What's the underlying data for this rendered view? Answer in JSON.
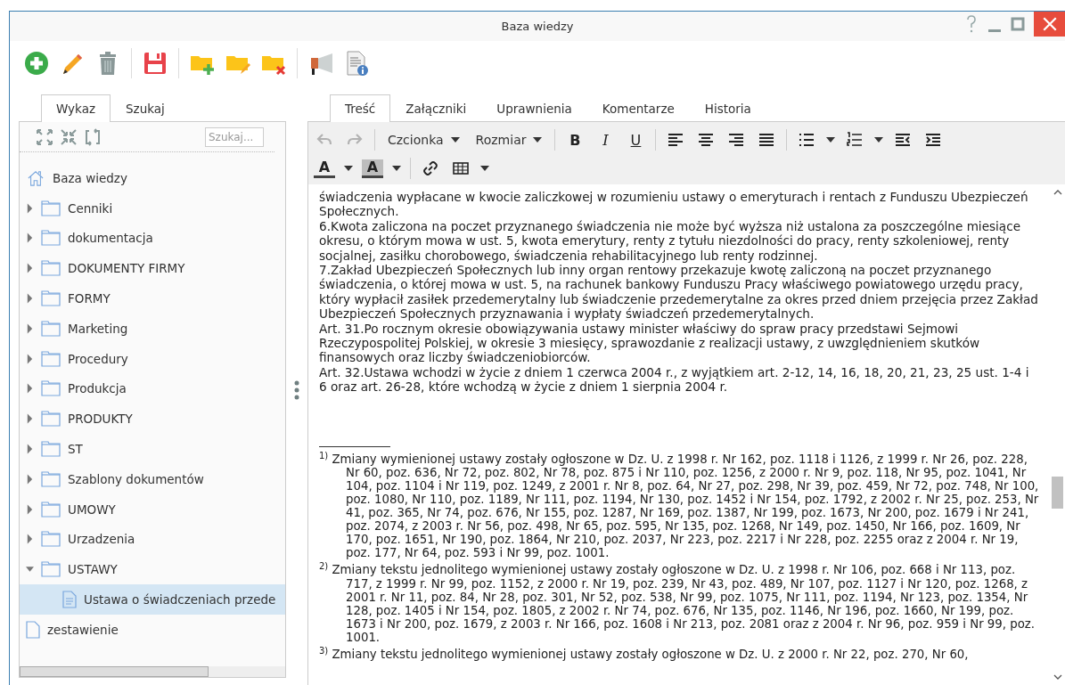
{
  "window": {
    "title": "Baza wiedzy"
  },
  "left_tabs": [
    {
      "label": "Wykaz",
      "selected": true
    },
    {
      "label": "Szukaj",
      "selected": false
    }
  ],
  "tree_search": {
    "placeholder": "Szukaj..."
  },
  "tree": [
    {
      "kind": "root",
      "label": "Baza wiedzy",
      "selected": false
    },
    {
      "kind": "folder",
      "label": "Cenniki",
      "expanded": false,
      "selected": false
    },
    {
      "kind": "folder",
      "label": "dokumentacja",
      "expanded": false,
      "selected": false
    },
    {
      "kind": "folder",
      "label": "DOKUMENTY FIRMY",
      "expanded": false,
      "selected": false
    },
    {
      "kind": "folder",
      "label": "FORMY",
      "expanded": false,
      "selected": false
    },
    {
      "kind": "folder",
      "label": "Marketing",
      "expanded": false,
      "selected": false
    },
    {
      "kind": "folder",
      "label": "Procedury",
      "expanded": false,
      "selected": false
    },
    {
      "kind": "folder",
      "label": "Produkcja",
      "expanded": false,
      "selected": false
    },
    {
      "kind": "folder",
      "label": "PRODUKTY",
      "expanded": false,
      "selected": false
    },
    {
      "kind": "folder",
      "label": "ST",
      "expanded": false,
      "selected": false
    },
    {
      "kind": "folder",
      "label": "Szablony dokumentów",
      "expanded": false,
      "selected": false
    },
    {
      "kind": "folder",
      "label": "UMOWY",
      "expanded": false,
      "selected": false
    },
    {
      "kind": "folder",
      "label": "Urzadzenia",
      "expanded": false,
      "selected": false
    },
    {
      "kind": "folder",
      "label": "USTAWY",
      "expanded": true,
      "selected": false,
      "children": [
        {
          "kind": "document",
          "label": "Ustawa o świadczeniach przede",
          "selected": true
        }
      ]
    },
    {
      "kind": "file",
      "label": "zestawienie",
      "selected": false
    }
  ],
  "right_tabs": [
    {
      "label": "Treść",
      "selected": true
    },
    {
      "label": "Załączniki",
      "selected": false
    },
    {
      "label": "Uprawnienia",
      "selected": false
    },
    {
      "label": "Komentarze",
      "selected": false
    },
    {
      "label": "Historia",
      "selected": false
    }
  ],
  "editor_toolbar": {
    "font": "Czcionka",
    "size": "Rozmiar",
    "bold": "B",
    "italic": "I",
    "underline": "U",
    "text_color": "A",
    "highlight": "A"
  },
  "content": [
    "świadczenia wypłacane w kwocie zaliczkowej w rozumieniu ustawy o emeryturach i rentach z Funduszu Ubezpieczeń Społecznych.",
    "6.Kwota zaliczona na poczet przyznanego świadczenia nie może być wyższa niż ustalona za poszczególne miesiące okresu, o którym mowa w ust. 5, kwota emerytury, renty z tytułu niezdolności do pracy, renty szkoleniowej, renty socjalnej, zasiłku chorobowego, świadczenia rehabilitacyjnego lub renty rodzinnej.",
    "7.Zakład Ubezpieczeń Społecznych lub inny organ rentowy przekazuje kwotę zaliczoną na poczet przyznanego świadczenia, o której mowa w ust. 5, na rachunek bankowy Funduszu Pracy właściwego powiatowego urzędu pracy, który wypłacił zasiłek przedemerytalny lub świadczenie przedemerytalne za okres przed dniem przejęcia przez Zakład Ubezpieczeń Społecznych przyznawania i wypłaty świadczeń przedemerytalnych.",
    "Art. 31.Po rocznym okresie obowiązywania ustawy minister właściwy do spraw pracy przedstawi Sejmowi Rzeczypospolitej Polskiej, w okresie 3 miesięcy, sprawozdanie z realizacji ustawy, z uwzględnieniem skutków finansowych oraz liczby świadczeniobiorców.",
    "Art. 32.Ustawa wchodzi w życie z dniem 1 czerwca 2004 r., z wyjątkiem art. 2-12, 14, 16, 18, 20, 21, 23, 25 ust. 1-4 i 6 oraz art. 26-28, które wchodzą w życie z dniem 1 sierpnia 2004 r."
  ],
  "footnotes": [
    {
      "mark": "1)",
      "text": "Zmiany wymienionej ustawy zostały ogłoszone w Dz. U. z 1998 r. Nr 162, poz. 1118 i 1126, z 1999 r. Nr 26, poz. 228, Nr 60, poz. 636, Nr 72, poz. 802, Nr 78, poz. 875 i Nr 110, poz. 1256, z 2000 r. Nr 9, poz. 118, Nr 95, poz. 1041, Nr 104, poz. 1104 i Nr 119, poz. 1249, z 2001 r. Nr 8, poz. 64, Nr 27, poz. 298, Nr 39, poz. 459, Nr 72, poz. 748, Nr 100, poz. 1080, Nr 110, poz. 1189, Nr 111, poz. 1194, Nr 130, poz. 1452 i Nr 154, poz. 1792, z 2002 r. Nr 25, poz. 253, Nr 41, poz. 365, Nr 74, poz. 676, Nr 155, poz. 1287, Nr 169, poz. 1387, Nr 199, poz. 1673, Nr 200, poz. 1679 i Nr 241, poz. 2074, z 2003 r. Nr 56, poz. 498, Nr 65, poz. 595, Nr 135, poz. 1268, Nr 149, poz. 1450, Nr 166, poz. 1609, Nr 170, poz. 1651, Nr 190, poz. 1864, Nr 210, poz. 2037, Nr 223, poz. 2217 i Nr 228, poz. 2255 oraz z 2004 r. Nr 19, poz. 177, Nr 64, poz. 593 i Nr 99, poz. 1001."
    },
    {
      "mark": "2)",
      "text": "Zmiany tekstu jednolitego wymienionej ustawy zostały ogłoszone w Dz. U. z 1998 r. Nr 106, poz. 668 i Nr 113, poz. 717, z 1999 r. Nr 99, poz. 1152, z 2000 r. Nr 19, poz. 239, Nr 43, poz. 489, Nr 107, poz. 1127 i Nr 120, poz. 1268, z 2001 r. Nr 11, poz. 84, Nr 28, poz. 301, Nr 52, poz. 538, Nr 99, poz. 1075, Nr 111, poz. 1194, Nr 123, poz. 1354, Nr 128, poz. 1405 i Nr 154, poz. 1805, z 2002 r. Nr 74, poz. 676, Nr 135, poz. 1146, Nr 196, poz. 1660, Nr 199, poz. 1673 i Nr 200, poz. 1679, z 2003 r. Nr 166, poz. 1608 i Nr 213, poz. 2081 oraz z 2004 r. Nr 96, poz. 959 i Nr 99, poz. 1001."
    },
    {
      "mark": "3)",
      "text": "Zmiany tekstu jednolitego wymienionej ustawy zostały ogłoszone w Dz. U. z 2000 r. Nr 22, poz. 270, Nr 60,"
    }
  ]
}
